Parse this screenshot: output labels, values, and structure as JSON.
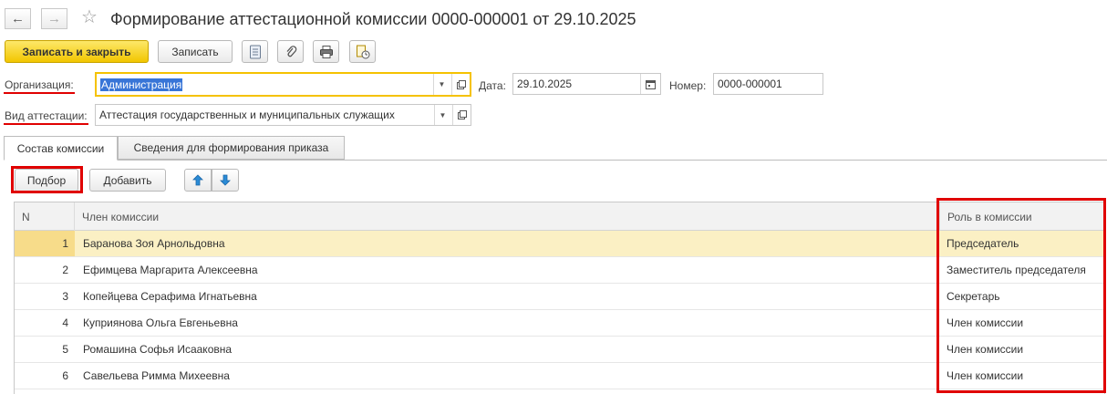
{
  "header": {
    "title": "Формирование аттестационной комиссии 0000-000001 от 29.10.2025",
    "back_icon": "←",
    "forward_icon": "→",
    "star_icon": "☆"
  },
  "toolbar": {
    "save_close_label": "Записать и закрыть",
    "save_label": "Записать",
    "icons": [
      "document-list-icon",
      "paperclip-icon",
      "print-icon",
      "report-clock-icon"
    ]
  },
  "form": {
    "org_label": "Организация:",
    "org_value": "Администрация",
    "date_label": "Дата:",
    "date_value": "29.10.2025",
    "number_label": "Номер:",
    "number_value": "0000-000001",
    "type_label": "Вид аттестации:",
    "type_value": "Аттестация государственных и муниципальных служащих"
  },
  "tabs": [
    {
      "label": "Состав комиссии",
      "active": true
    },
    {
      "label": "Сведения для формирования приказа",
      "active": false
    }
  ],
  "table_toolbar": {
    "pick_label": "Подбор",
    "add_label": "Добавить"
  },
  "table": {
    "columns": [
      "N",
      "Член комиссии",
      "Роль в комиссии"
    ],
    "rows": [
      {
        "n": "1",
        "name": "Баранова Зоя Арнольдовна",
        "role": "Председатель"
      },
      {
        "n": "2",
        "name": "Ефимцева Маргарита Алексеевна",
        "role": "Заместитель председателя"
      },
      {
        "n": "3",
        "name": "Копейцева Серафима Игнатьевна",
        "role": "Секретарь"
      },
      {
        "n": "4",
        "name": "Куприянова Ольга Евгеньевна",
        "role": "Член комиссии"
      },
      {
        "n": "5",
        "name": "Ромашина Софья Исааковна",
        "role": "Член комиссии"
      },
      {
        "n": "6",
        "name": "Савельева Римма Михеевна",
        "role": "Член комиссии"
      }
    ]
  },
  "colors": {
    "accent_yellow": "#f5c200",
    "highlight_red": "#e00000",
    "selected_row": "#fbf0c4"
  }
}
